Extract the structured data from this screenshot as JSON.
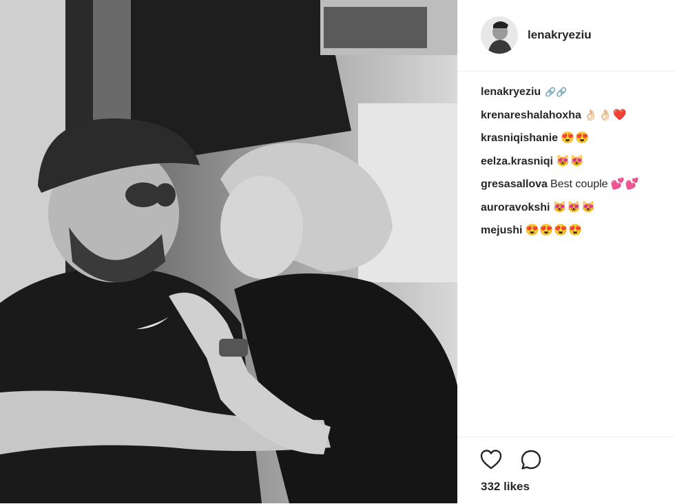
{
  "post": {
    "username": "lenakryeziu",
    "likes_text": "332 likes"
  },
  "comments": [
    {
      "user": "lenakryeziu",
      "text": "",
      "emoji": "🔗🔗"
    },
    {
      "user": "krenareshalahoxha",
      "text": "",
      "emoji": "👌🏻👌🏻❤️"
    },
    {
      "user": "krasniqishanie",
      "text": "",
      "emoji": "😍😍"
    },
    {
      "user": "eelza.krasniqi",
      "text": "",
      "emoji": "😻😻"
    },
    {
      "user": "gresasallova",
      "text": "Best couple",
      "emoji": "💕💕"
    },
    {
      "user": "auroravokshi",
      "text": "",
      "emoji": "😻😻😻"
    },
    {
      "user": "mejushi",
      "text": "",
      "emoji": "😍😍😍😍"
    }
  ],
  "icons": {
    "like": "heart-icon",
    "comment": "speech-bubble-icon"
  }
}
